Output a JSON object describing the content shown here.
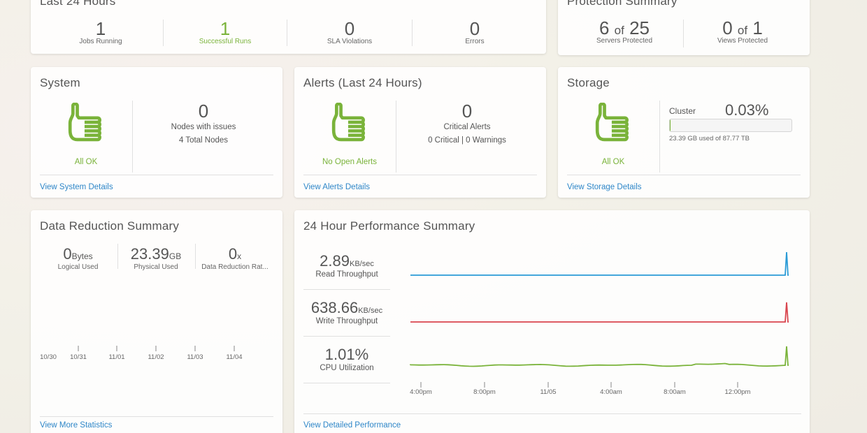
{
  "last24": {
    "title": "Last 24 Hours",
    "stats": [
      {
        "value": "1",
        "label": "Jobs Running"
      },
      {
        "value": "1",
        "label": "Successful Runs"
      },
      {
        "value": "0",
        "label": "SLA Violations"
      },
      {
        "value": "0",
        "label": "Errors"
      }
    ]
  },
  "protection": {
    "title": "Protection Summary",
    "servers": {
      "a": "6",
      "of": "of",
      "b": "25",
      "label": "Servers Protected"
    },
    "views": {
      "a": "0",
      "of": "of",
      "b": "1",
      "label": "Views Protected"
    }
  },
  "system": {
    "title": "System",
    "status": "All OK",
    "nodes_value": "0",
    "nodes_label": "Nodes with issues",
    "total_nodes": "4 Total Nodes",
    "link": "View System Details"
  },
  "alerts": {
    "title": "Alerts (Last 24 Hours)",
    "status": "No Open Alerts",
    "value": "0",
    "label": "Critical Alerts",
    "detail": "0 Critical | 0 Warnings",
    "link": "View Alerts Details"
  },
  "storage": {
    "title": "Storage",
    "status": "All OK",
    "cluster_label": "Cluster",
    "percent": "0.03%",
    "used_fraction": 0.0003,
    "used_text": "23.39 GB used of 87.77 TB",
    "link": "View Storage Details"
  },
  "reduction": {
    "title": "Data Reduction Summary",
    "logical": {
      "value": "0",
      "unit": "Bytes",
      "label": "Logical Used"
    },
    "physical": {
      "value": "23.39",
      "unit": "GB",
      "label": "Physical Used"
    },
    "ratio": {
      "value": "0",
      "unit": "x",
      "label": "Data Reduction Rat..."
    },
    "dates": [
      "10/30",
      "10/31",
      "11/01",
      "11/02",
      "11/03",
      "11/04"
    ],
    "link": "View More Statistics"
  },
  "performance": {
    "title": "24 Hour Performance Summary",
    "metrics": [
      {
        "value": "2.89",
        "unit": "KB/sec",
        "label": "Read Throughput",
        "color": "#2a9bd6"
      },
      {
        "value": "638.66",
        "unit": "KB/sec",
        "label": "Write Throughput",
        "color": "#d9464f"
      },
      {
        "value": "1.01%",
        "unit": "",
        "label": "CPU Utilization",
        "color": "#7ab33a"
      }
    ],
    "x_ticks": [
      "4:00pm",
      "8:00pm",
      "11/05",
      "4:00am",
      "8:00am",
      "12:00pm"
    ],
    "link": "View Detailed Performance"
  },
  "colors": {
    "accent": "#7ab33a",
    "link": "#2d86c8"
  }
}
